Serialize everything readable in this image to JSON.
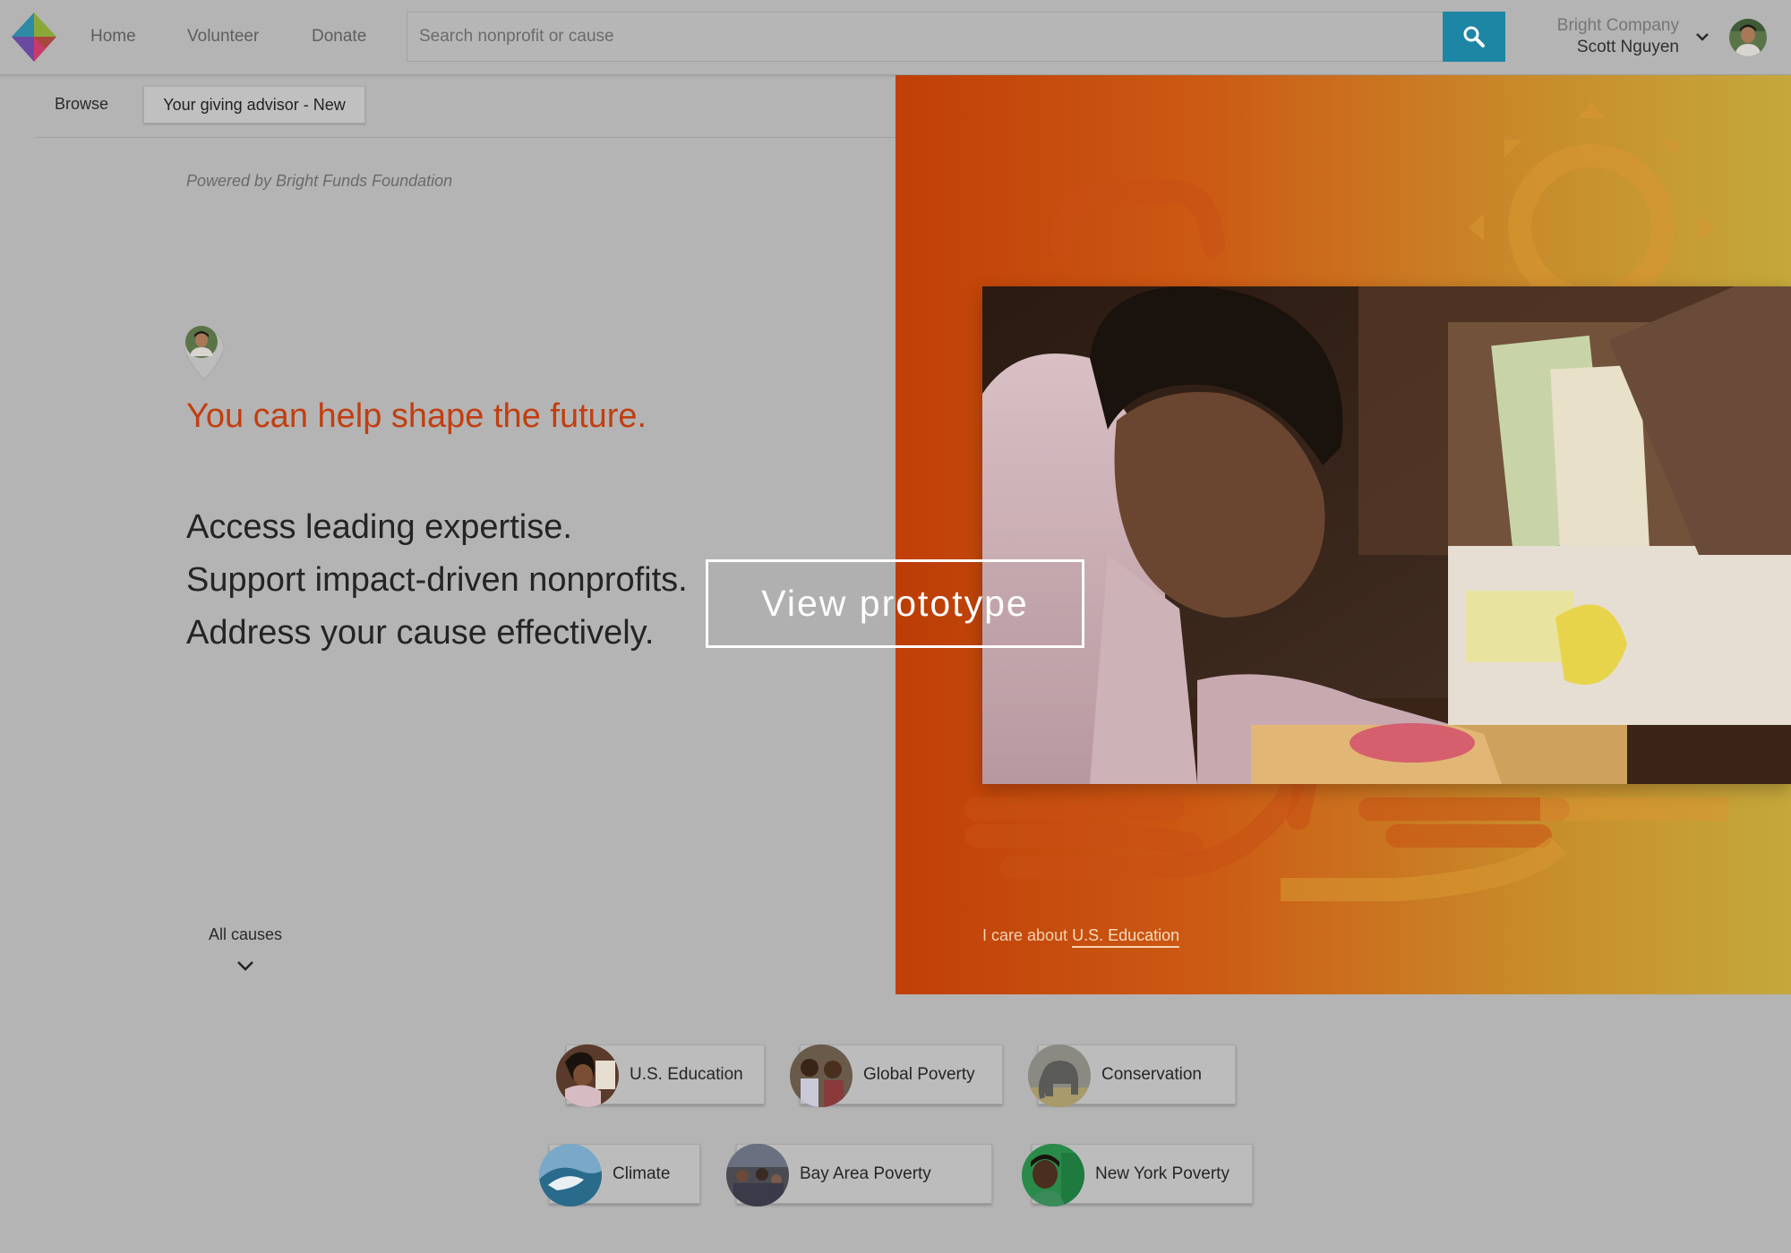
{
  "header": {
    "nav": {
      "home": "Home",
      "volunteer": "Volunteer",
      "donate": "Donate"
    },
    "search": {
      "placeholder": "Search nonprofit or cause"
    },
    "account": {
      "company": "Bright Company",
      "user": "Scott Nguyen"
    }
  },
  "tabs": {
    "browse": "Browse",
    "advisor": "Your giving advisor - New"
  },
  "intro": {
    "powered_by": "Powered by Bright Funds Foundation",
    "headline": "You can help shape the future.",
    "lines": [
      "Access leading expertise.",
      "Support impact-driven nonprofits.",
      "Address your cause effectively."
    ],
    "all_causes": "All causes"
  },
  "hero": {
    "care_prefix": "I care about",
    "care_link": "U.S. Education"
  },
  "overlay": {
    "view_prototype": "View prototype"
  },
  "causes": [
    "U.S. Education",
    "Global Poverty",
    "Conservation",
    "Climate",
    "Bay Area Poverty",
    "New York Poverty"
  ],
  "colors": {
    "accent_orange": "#c23e10",
    "search_button": "#1d86a4",
    "hero_gradient_start": "#c03f07",
    "hero_gradient_end": "#c4a83c"
  },
  "icons": [
    "logo-icon",
    "search-icon",
    "chevron-down-icon",
    "avatar",
    "location-pin-icon"
  ]
}
